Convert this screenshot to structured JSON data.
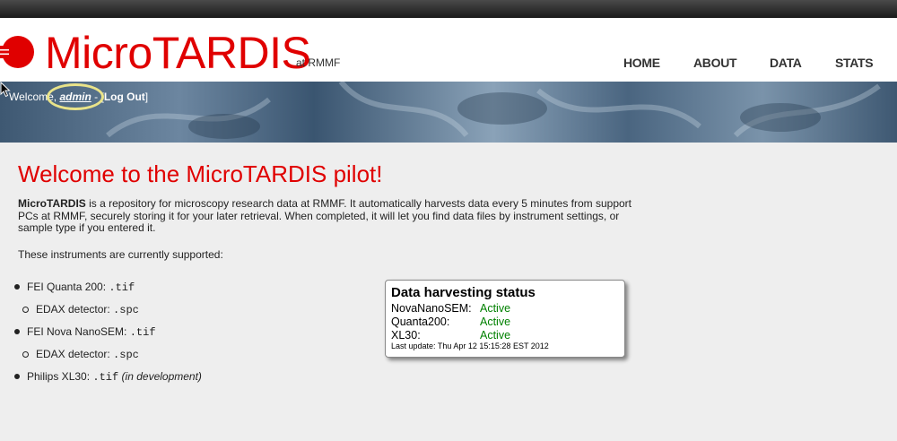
{
  "brand": {
    "name": "MicroTARDIS",
    "sub": "at RMMF"
  },
  "nav": [
    "HOME",
    "ABOUT",
    "DATA",
    "STATS"
  ],
  "user": {
    "prefix": "Welcome, ",
    "name": "admin",
    "separator": " - [",
    "logout": "Log Out",
    "suffix": "]"
  },
  "page": {
    "title": "Welcome to the MicroTARDIS pilot!",
    "intro_bold": "MicroTARDIS",
    "intro_rest": " is a repository for microscopy research data at RMMF. It automatically harvests data every 5 minutes from support PCs at RMMF, securely storing it for your later retrieval. When completed, it will let you find data files by instrument settings, or sample type if you entered it.",
    "supported": "These instruments are currently supported:"
  },
  "instruments": [
    {
      "label": "FEI Quanta 200: ",
      "ext": ".tif",
      "note": ""
    },
    {
      "label": "EDAX detector: ",
      "ext": ".spc",
      "note": ""
    },
    {
      "label": "FEI Nova NanoSEM: ",
      "ext": ".tif",
      "note": ""
    },
    {
      "label": "EDAX detector: ",
      "ext": ".spc",
      "note": ""
    },
    {
      "label": "Philips XL30: ",
      "ext": ".tif",
      "note": "(in development)"
    }
  ],
  "status": {
    "title": "Data harvesting status",
    "rows": [
      {
        "name": "NovaNanoSEM:",
        "value": "Active"
      },
      {
        "name": "Quanta200:",
        "value": "Active"
      },
      {
        "name": "XL30:",
        "value": "Active"
      }
    ],
    "last_update": "Last update: Thu Apr 12 15:15:28 EST 2012"
  },
  "colors": {
    "accent": "#e00000",
    "active": "#008000"
  },
  "icons": [
    "logo-icon",
    "mouse-cursor-icon"
  ]
}
